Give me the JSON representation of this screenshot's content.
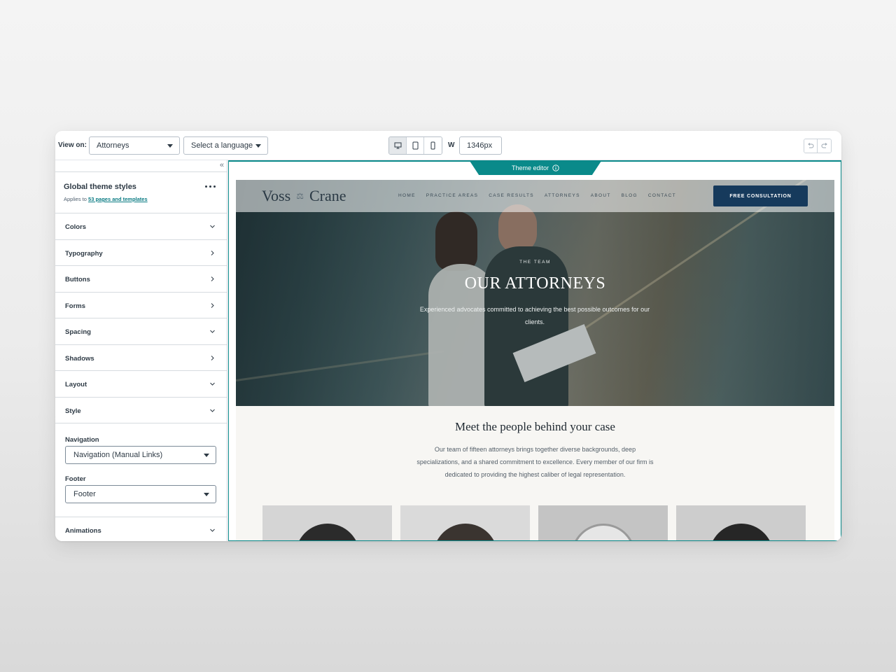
{
  "toolbar": {
    "view_on_label": "View on:",
    "view_on_value": "Attorneys",
    "language_value": "Select a language",
    "width_label": "W",
    "width_value": "1346px"
  },
  "sidebar": {
    "collapse_glyph": "«",
    "global_title": "Global theme styles",
    "applies_prefix": "Applies to ",
    "applies_link": "53 pages and templates",
    "sections": [
      {
        "label": "Colors",
        "state": "expanded"
      },
      {
        "label": "Typography",
        "state": "collapsed"
      },
      {
        "label": "Buttons",
        "state": "collapsed"
      },
      {
        "label": "Forms",
        "state": "collapsed"
      },
      {
        "label": "Spacing",
        "state": "expanded"
      },
      {
        "label": "Shadows",
        "state": "collapsed"
      },
      {
        "label": "Layout",
        "state": "expanded"
      },
      {
        "label": "Style",
        "state": "expanded"
      }
    ],
    "navigation_label": "Navigation",
    "navigation_value": "Navigation (Manual Links)",
    "footer_label": "Footer",
    "footer_value": "Footer",
    "animations_label": "Animations"
  },
  "preview": {
    "tab_label": "Theme editor",
    "accent_color": "#0a8a8a"
  },
  "site": {
    "logo_left": "Voss",
    "logo_mark": "⚖",
    "logo_right": "Crane",
    "menu": [
      "HOME",
      "PRACTICE AREAS",
      "CASE RESULTS",
      "ATTORNEYS",
      "ABOUT",
      "BLOG",
      "CONTACT"
    ],
    "cta": "FREE CONSULTATION",
    "cta_color": "#163a5c",
    "hero_eyebrow": "THE TEAM",
    "hero_title": "OUR ATTORNEYS",
    "hero_sub": "Experienced advocates committed to achieving the best possible outcomes for our clients.",
    "team_title": "Meet the people behind your case",
    "team_text": "Our team of fifteen attorneys brings together diverse backgrounds, deep specializations, and a shared commitment to excellence. Every member of our firm is dedicated to providing the highest caliber of legal representation."
  }
}
